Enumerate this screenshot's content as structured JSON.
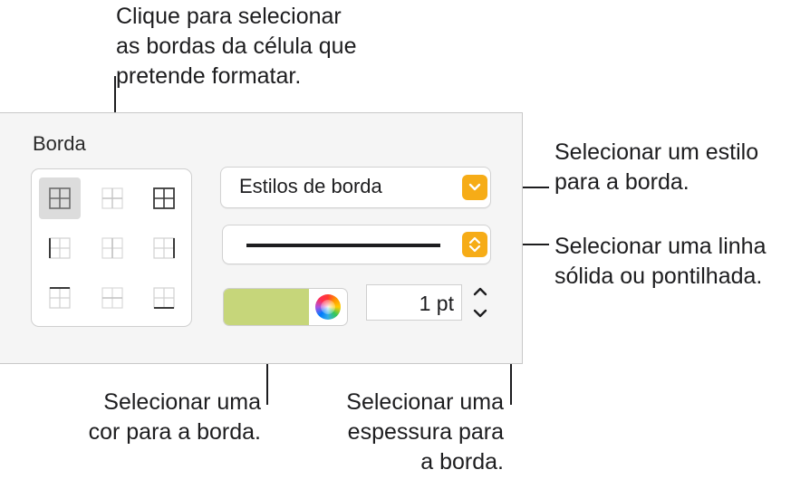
{
  "callouts": {
    "top": [
      "Clique para selecionar",
      "as bordas da célula que",
      "pretende formatar."
    ],
    "style": [
      "Selecionar um estilo",
      "para a borda."
    ],
    "line": [
      "Selecionar uma linha",
      "sólida ou pontilhada."
    ],
    "color": [
      "Selecionar uma",
      "cor para a borda."
    ],
    "width": [
      "Selecionar uma",
      "espessura para",
      "a borda."
    ]
  },
  "panel": {
    "section_title": "Borda",
    "border_style_label": "Estilos de borda",
    "width_value": "1 pt",
    "color_hex": "#c6d67a",
    "accent": "#f6ac17",
    "selected_border_button": "all-borders"
  },
  "border_buttons": [
    "all-borders",
    "inside-borders",
    "outside-borders",
    "left-border",
    "vertical-inside-border",
    "right-border",
    "top-border",
    "horizontal-inside-border",
    "bottom-border"
  ]
}
